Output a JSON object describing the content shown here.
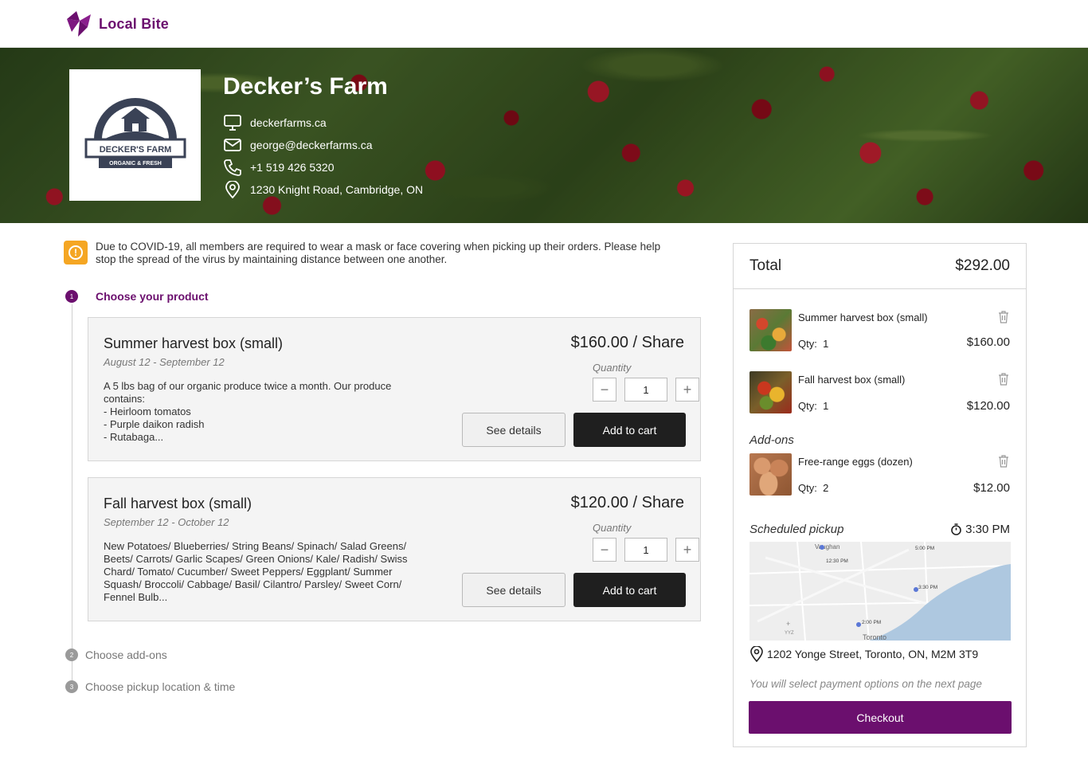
{
  "brand": {
    "name": "Local Bite",
    "color": "#6b0f6e"
  },
  "farm": {
    "name": "Decker’s Farm",
    "logo_text": "DECKER'S FARM",
    "logo_subtext": "ORGANIC & FRESH",
    "website": "deckerfarms.ca",
    "email": "george@deckerfarms.ca",
    "phone": "+1 519 426 5320",
    "address": "1230 Knight Road, Cambridge, ON"
  },
  "notice": {
    "icon": "warning-icon",
    "text": "Due to COVID-19, all members are required to wear a mask or face covering when picking up their orders. Please help stop the spread of the virus by maintaining distance between one another.",
    "color": "#f5a623"
  },
  "steps": [
    {
      "num": "1",
      "label": "Choose your product"
    },
    {
      "num": "2",
      "label": "Choose add-ons"
    },
    {
      "num": "3",
      "label": "Choose pickup location & time"
    }
  ],
  "products": [
    {
      "title": "Summer harvest box (small)",
      "dates": "August 12 - September 12",
      "description": "A 5 lbs bag of our organic produce twice a month. Our produce contains:\n  - Heirloom tomatos\n  - Purple daikon radish\n  - Rutabaga...",
      "price": "$160.00 / Share",
      "quantity_label": "Quantity",
      "quantity": "1",
      "details_label": "See details",
      "cart_label": "Add to cart"
    },
    {
      "title": "Fall harvest box (small)",
      "dates": "September 12 - October 12",
      "description": "New Potatoes/ Blueberries/ String Beans/ Spinach/ Salad Greens/ Beets/ Carrots/ Garlic Scapes/ Green Onions/ Kale/ Radish/ Swiss Chard/ Tomato/ Cucumber/ Sweet Peppers/ Eggplant/ Summer Squash/ Broccoli/ Cabbage/ Basil/ Cilantro/ Parsley/ Sweet Corn/ Fennel Bulb...",
      "price": "$120.00 / Share",
      "quantity_label": "Quantity",
      "quantity": "1",
      "details_label": "See details",
      "cart_label": "Add to cart"
    }
  ],
  "cart": {
    "total_label": "Total",
    "total": "$292.00",
    "items": [
      {
        "name": "Summer harvest box (small)",
        "qty_label": "Qty:",
        "qty": "1",
        "price": "$160.00"
      },
      {
        "name": "Fall harvest box (small)",
        "qty_label": "Qty:",
        "qty": "1",
        "price": "$120.00"
      }
    ],
    "addons_label": "Add-ons",
    "addons": [
      {
        "name": "Free-range eggs (dozen)",
        "qty_label": "Qty:",
        "qty": "2",
        "price": "$12.00"
      }
    ],
    "pickup_label": "Scheduled pickup",
    "pickup_time": "3:30 PM",
    "map_labels": {
      "city1": "Vaughan",
      "city2": "Toronto",
      "airport": "YYZ",
      "t1": "12:30 PM",
      "t2": "5:00 PM",
      "t3": "3:30 PM",
      "t4": "2:00 PM"
    },
    "pickup_address": "1202 Yonge Street, Toronto, ON, M2M 3T9",
    "payment_note": "You will select payment options on the next page",
    "checkout_label": "Checkout"
  }
}
